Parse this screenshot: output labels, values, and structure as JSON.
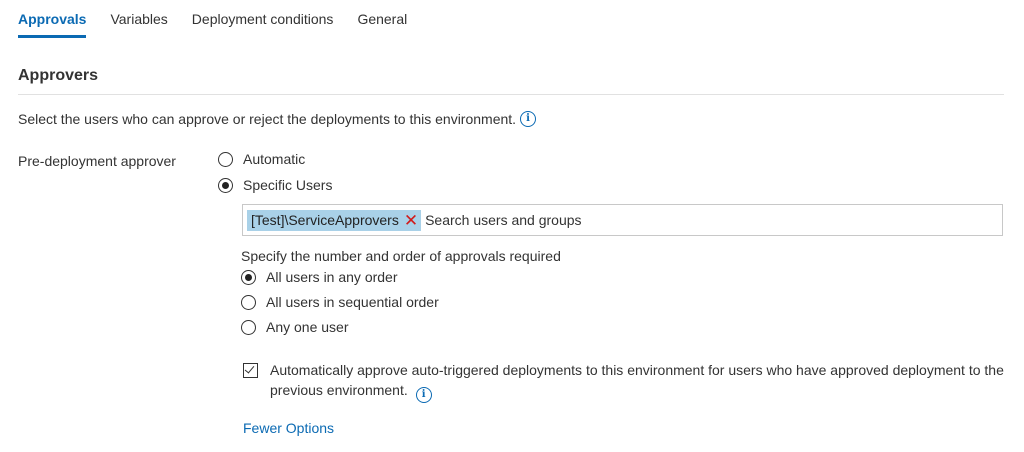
{
  "tabs": [
    {
      "label": "Approvals",
      "active": true
    },
    {
      "label": "Variables"
    },
    {
      "label": "Deployment conditions"
    },
    {
      "label": "General"
    }
  ],
  "section": {
    "title": "Approvers",
    "description": "Select the users who can approve or reject the deployments to this environment.",
    "info_icon": "i"
  },
  "pre_deployment": {
    "label": "Pre-deployment approver",
    "options": [
      {
        "label": "Automatic",
        "selected": false
      },
      {
        "label": "Specific Users",
        "selected": true
      }
    ]
  },
  "user_picker": {
    "chip_label": "[Test]\\ServiceApprovers",
    "remove_icon": "✕",
    "placeholder": "Search users and groups"
  },
  "approval_order": {
    "label": "Specify the number and order of approvals required",
    "options": [
      {
        "label": "All users in any order",
        "selected": true
      },
      {
        "label": "All users in sequential order",
        "selected": false
      },
      {
        "label": "Any one user",
        "selected": false
      }
    ]
  },
  "auto_approve": {
    "checked": true,
    "text": "Automatically approve auto-triggered deployments to this environment for users who have approved deployment to the previous environment."
  },
  "fewer_options": "Fewer Options",
  "colors": {
    "accent": "#0b6ab3",
    "chip_bg": "#a9d1e8",
    "remove": "#d11a1a"
  }
}
